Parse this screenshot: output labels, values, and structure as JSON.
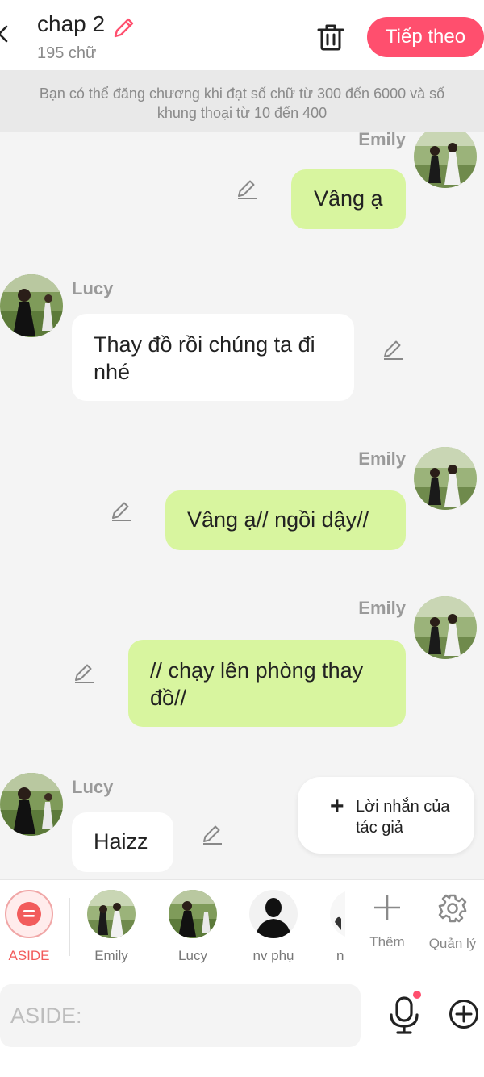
{
  "header": {
    "title": "chap 2",
    "word_count": "195 chữ",
    "next_label": "Tiếp theo"
  },
  "notice": {
    "line1": "Bạn có thể đăng chương khi đạt số chữ từ 300 đến 6000 và số",
    "line2": "khung thoại từ 10 đến 400"
  },
  "messages": [
    {
      "speaker": "Emily",
      "side": "right",
      "text": "Vâng ạ"
    },
    {
      "speaker": "Lucy",
      "side": "left",
      "text": "Thay đồ rồi chúng ta đi nhé"
    },
    {
      "speaker": "Emily",
      "side": "right",
      "text": "Vâng ạ// ngồi dậy//"
    },
    {
      "speaker": "Emily",
      "side": "right",
      "text": "// chạy lên phòng thay đồ//"
    },
    {
      "speaker": "Lucy",
      "side": "left",
      "text": "Haizz"
    }
  ],
  "author_note": {
    "label": "Lời nhắn của tác giả"
  },
  "characters": [
    {
      "label": "ASIDE",
      "selected": true
    },
    {
      "label": "Emily"
    },
    {
      "label": "Lucy"
    },
    {
      "label": "nv phụ"
    },
    {
      "label": "n"
    }
  ],
  "tools": {
    "add_label": "Thêm",
    "manage_label": "Quản lý"
  },
  "composer": {
    "placeholder": "ASIDE:"
  },
  "colors": {
    "accent": "#ff4f6e",
    "bubble_green": "#d8f59f",
    "aside_red": "#f25c5c"
  }
}
